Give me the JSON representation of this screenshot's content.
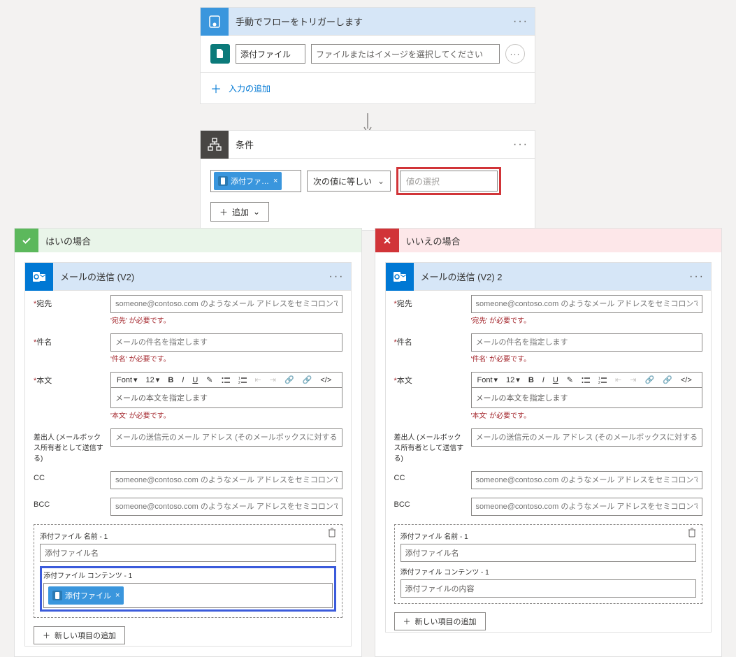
{
  "trigger": {
    "title": "手動でフローをトリガーします",
    "attachment_label": "添付ファイル",
    "file_placeholder": "ファイルまたはイメージを選択してください",
    "add_input": "入力の追加"
  },
  "condition": {
    "title": "条件",
    "token_label": "添付ファ…",
    "operator": "次の値に等しい",
    "value_placeholder": "値の選択",
    "add": "追加"
  },
  "branches": {
    "yes": {
      "title": "はいの場合"
    },
    "no": {
      "title": "いいえの場合"
    }
  },
  "email1": {
    "title": "メールの送信 (V2)",
    "to_label": "宛先",
    "to_placeholder": "someone@contoso.com のようなメール アドレスをセミコロンで区切って指定します",
    "to_err": "'宛先' が必要です。",
    "subject_label": "件名",
    "subject_placeholder": "メールの件名を指定します",
    "subject_err": "'件名' が必要です。",
    "body_label": "本文",
    "body_placeholder": "メールの本文を指定します",
    "body_err": "'本文' が必要です。",
    "font_label": "Font",
    "font_size": "12",
    "from_label": "差出人 (メールボックス所有者として送信する)",
    "from_placeholder": "メールの送信元のメール アドレス (そのメールボックスに対する「送信者」または「代理送信」",
    "cc_label": "CC",
    "cc_placeholder": "someone@contoso.com のようなメール アドレスをセミコロンで区切って指定します",
    "bcc_label": "BCC",
    "bcc_placeholder": "someone@contoso.com のようなメール アドレスをセミコロンで区切って指定します",
    "attach_name_label": "添付ファイル 名前 - 1",
    "attach_name_placeholder": "添付ファイル名",
    "attach_content_label": "添付ファイル コンテンツ - 1",
    "attach_token": "添付ファイル",
    "new_item": "新しい項目の追加"
  },
  "email2": {
    "title": "メールの送信 (V2) 2",
    "attach_content_placeholder": "添付ファイルの内容"
  }
}
